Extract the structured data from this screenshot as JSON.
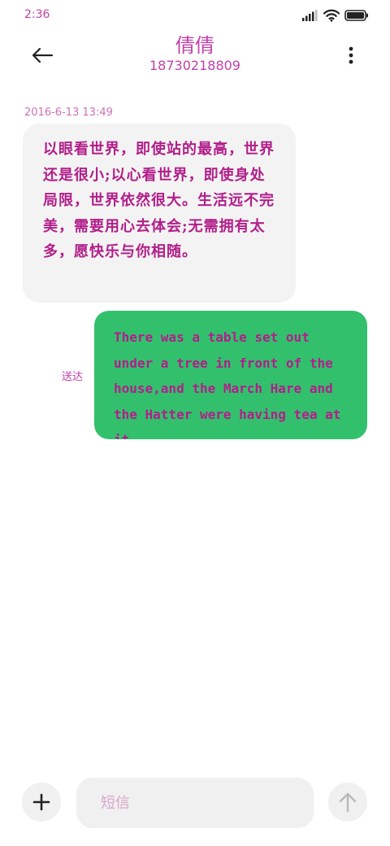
{
  "status_bar": {
    "time": "2:36",
    "icons": [
      "signal-icon",
      "wifi-icon",
      "battery-icon"
    ]
  },
  "header": {
    "contact_name": "倩倩",
    "phone_number": "18730218809",
    "back_icon": "arrow-left-icon",
    "more_icon": "more-vertical-icon"
  },
  "conversation": {
    "timestamp": "2016-6-13 13:49",
    "incoming": {
      "text": "以眼看世界，即使站的最高，世界还是很小;以心看世界，即使身处局限，世界依然很大。生活远不完美，需要用心去体会;无需拥有太多，愿快乐与你相随。"
    },
    "outgoing": {
      "status": "送达",
      "text": "There was a table set out under a tree in front of the house,and the March Hare and the Hatter were having tea at it."
    }
  },
  "composer": {
    "placeholder": "短信",
    "value": "",
    "add_icon": "plus-icon",
    "send_icon": "arrow-up-icon"
  },
  "colors": {
    "accent": "#c040a8",
    "incoming_bubble": "#f3f3f3",
    "outgoing_bubble": "#33c06d",
    "message_text": "#b21e8a"
  }
}
